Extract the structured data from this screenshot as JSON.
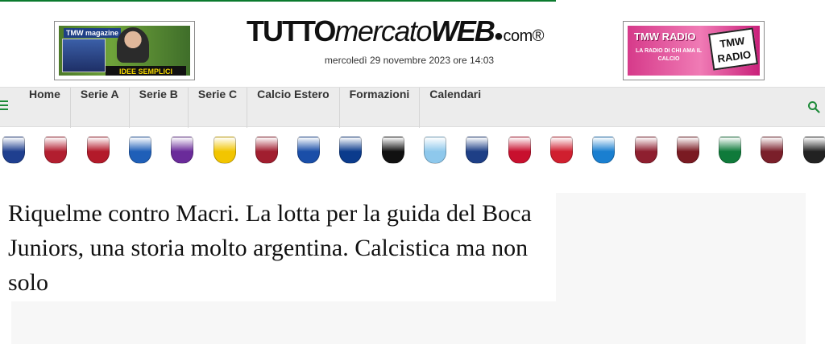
{
  "header": {
    "logo": {
      "part1": "TUTTO",
      "part2": "mercato",
      "part3": "WEB",
      "part4": "●com®"
    },
    "date": "mercoledì 29 novembre 2023 ore 14:03",
    "ad_left": {
      "brand": "TMW magazine",
      "headline": "IDEE SEMPLICI"
    },
    "ad_right": {
      "title": "TMW RADIO",
      "subtitle": "LA RADIO DI CHI AMA IL CALCIO",
      "badge": "TMW RADIO"
    }
  },
  "nav": {
    "items": [
      "Home",
      "Serie A",
      "Serie B",
      "Serie C",
      "Calcio Estero",
      "Formazioni",
      "Calendari"
    ],
    "accent": "#1e8b3a"
  },
  "teams": [
    {
      "name": "atalanta",
      "color": "#1f3f8f"
    },
    {
      "name": "bologna",
      "color": "#b21e2f"
    },
    {
      "name": "cagliari",
      "color": "#b31a2a"
    },
    {
      "name": "empoli",
      "color": "#1f5fb8"
    },
    {
      "name": "fiorentina",
      "color": "#6a2b9a"
    },
    {
      "name": "frosinone",
      "color": "#f2c500"
    },
    {
      "name": "genoa",
      "color": "#a11e2f"
    },
    {
      "name": "verona",
      "color": "#1a4ea8"
    },
    {
      "name": "inter",
      "color": "#0b3b8c"
    },
    {
      "name": "juventus",
      "color": "#111111"
    },
    {
      "name": "lazio",
      "color": "#8ec8ec"
    },
    {
      "name": "lecce",
      "color": "#1e3f86"
    },
    {
      "name": "milan",
      "color": "#c8102e"
    },
    {
      "name": "monza",
      "color": "#d01f2f"
    },
    {
      "name": "napoli",
      "color": "#1a7fd0"
    },
    {
      "name": "roma",
      "color": "#8e1f2f"
    },
    {
      "name": "salernitana",
      "color": "#7a1a22"
    },
    {
      "name": "sassuolo",
      "color": "#0f7a3a"
    },
    {
      "name": "torino",
      "color": "#7a1f2a"
    },
    {
      "name": "udinese",
      "color": "#222222"
    }
  ],
  "article": {
    "title": "Riquelme contro Macri. La lotta per la guida del Boca Juniors, una storia molto argentina. Calcistica ma non solo"
  }
}
